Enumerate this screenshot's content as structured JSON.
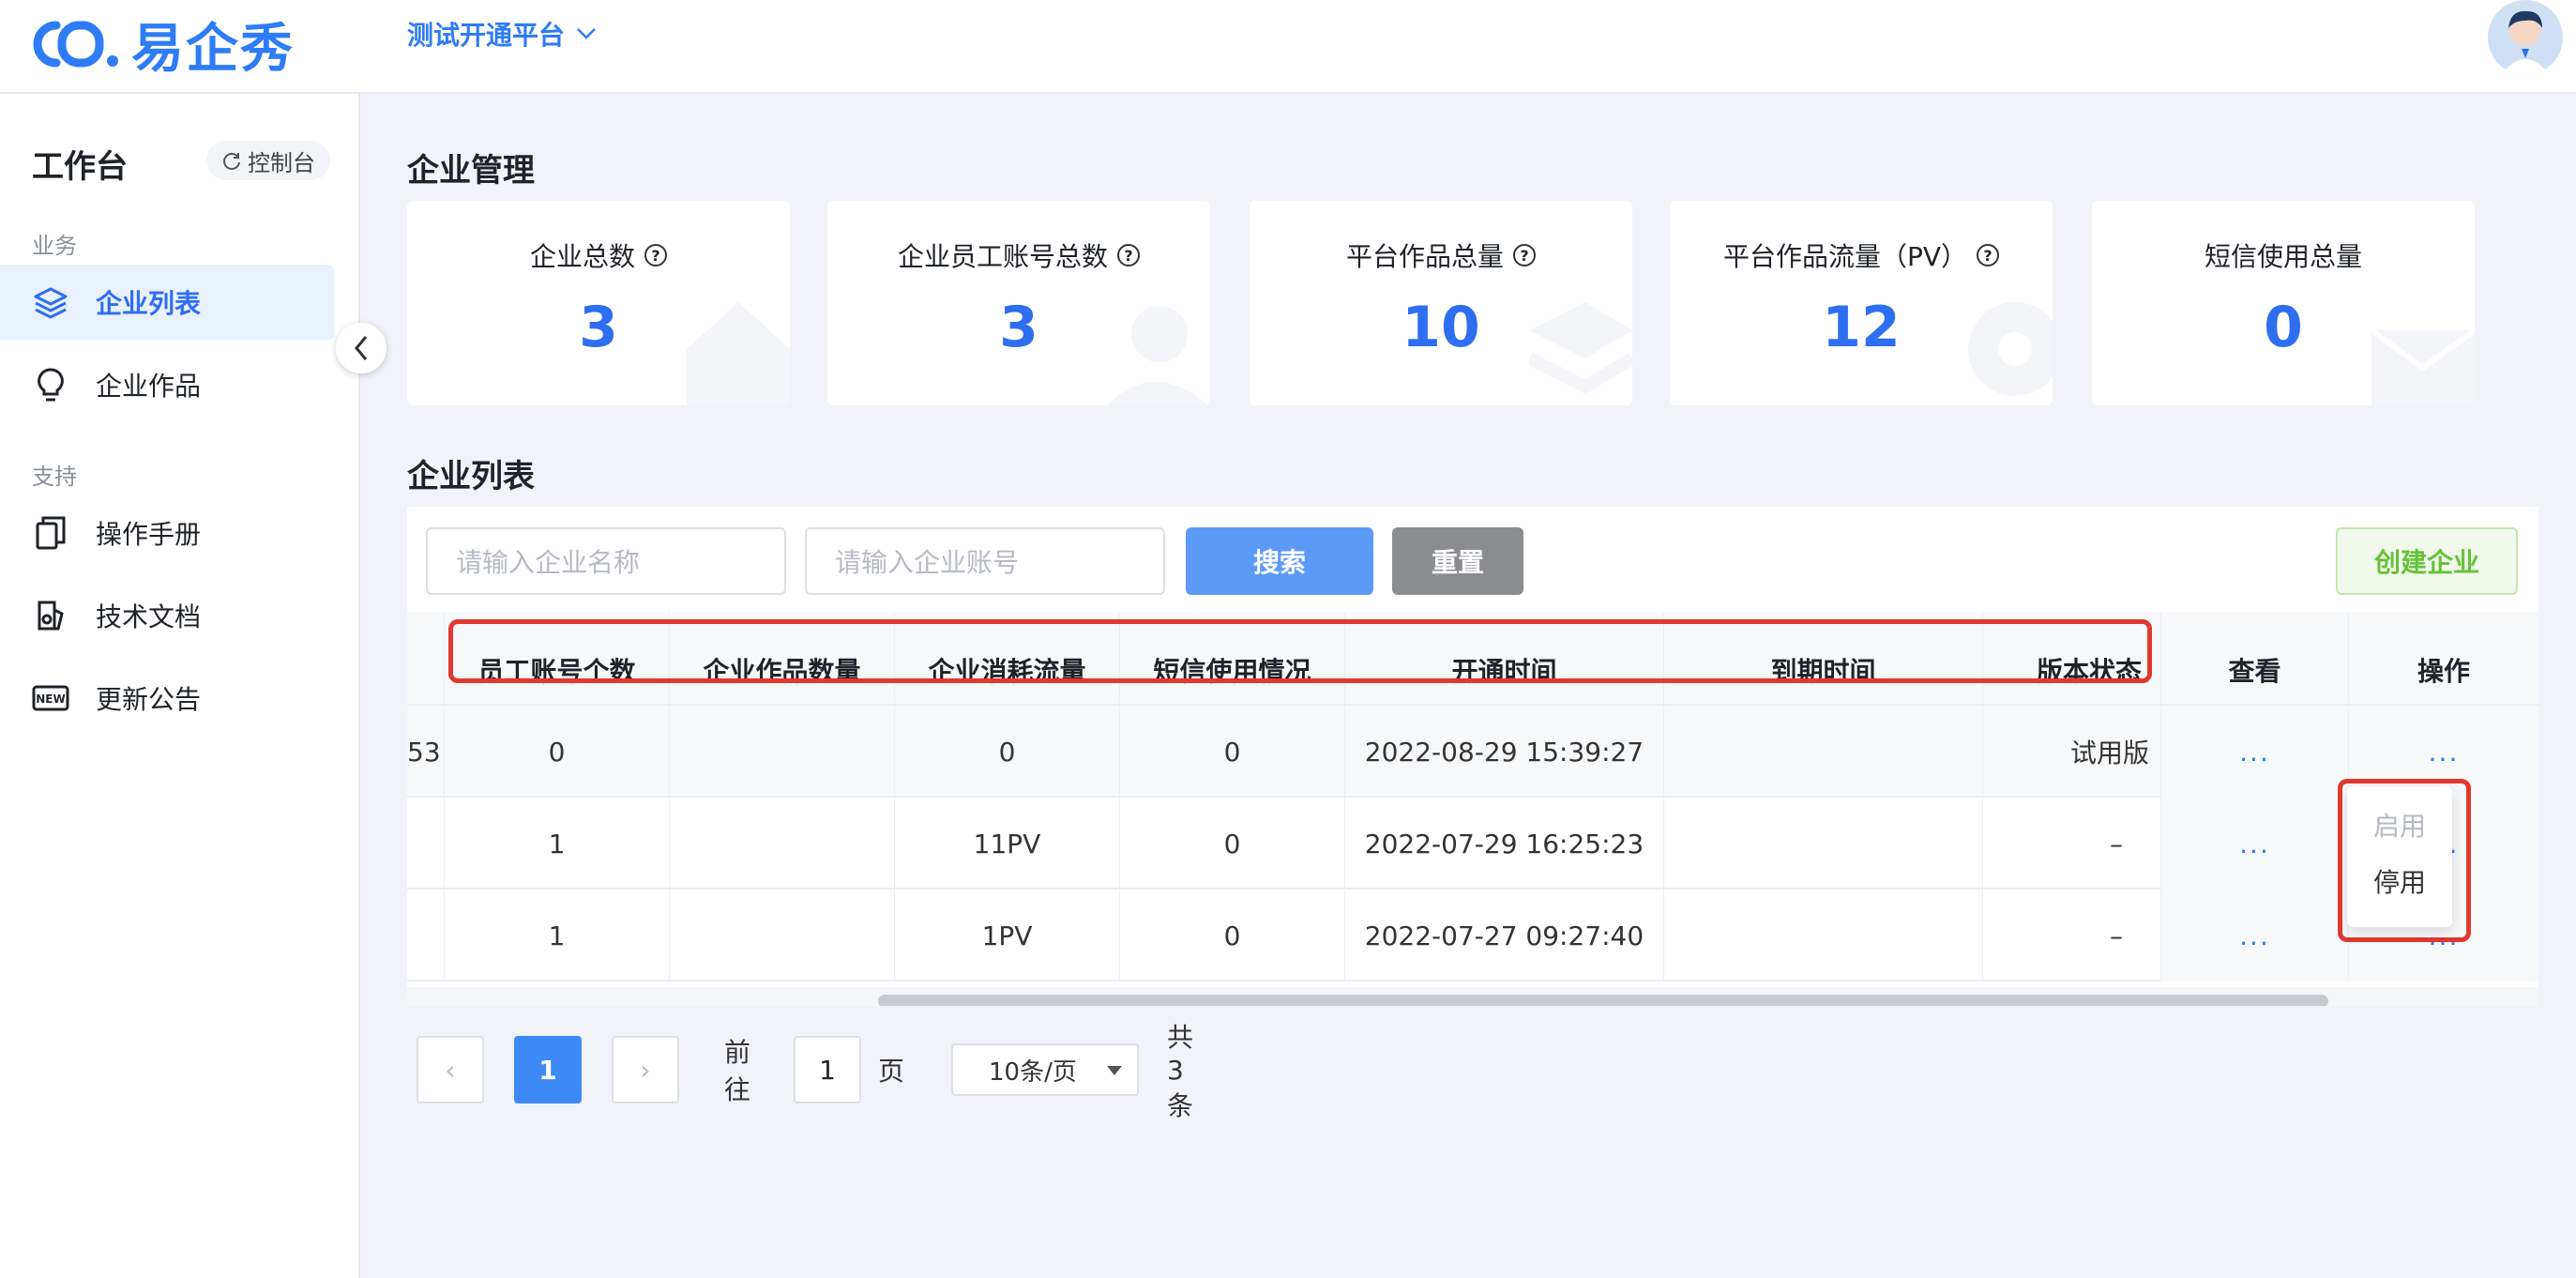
{
  "brand": {
    "logo_mark": "CO.",
    "logo_text": "易企秀",
    "accent_color": "#2e7cf6"
  },
  "header": {
    "platform_name": "测试开通平台"
  },
  "sidebar": {
    "title": "工作台",
    "console_label": "控制台",
    "groups": [
      {
        "label": "业务",
        "items": [
          {
            "label": "企业列表",
            "icon": "layers-icon",
            "active": true
          },
          {
            "label": "企业作品",
            "icon": "bulb-icon",
            "active": false
          }
        ]
      },
      {
        "label": "支持",
        "items": [
          {
            "label": "操作手册",
            "icon": "manual-icon"
          },
          {
            "label": "技术文档",
            "icon": "document-icon"
          },
          {
            "label": "更新公告",
            "icon": "new-icon"
          }
        ]
      }
    ]
  },
  "management": {
    "title": "企业管理",
    "stats": [
      {
        "label": "企业总数",
        "value": "3",
        "help": true
      },
      {
        "label": "企业员工账号总数",
        "value": "3",
        "help": true
      },
      {
        "label": "平台作品总量",
        "value": "10",
        "help": true
      },
      {
        "label": "平台作品流量（PV）",
        "value": "12",
        "help": true
      },
      {
        "label": "短信使用总量",
        "value": "0",
        "help": false
      }
    ]
  },
  "list": {
    "title": "企业列表",
    "search_name_placeholder": "请输入企业名称",
    "search_account_placeholder": "请输入企业账号",
    "search_button": "搜索",
    "reset_button": "重置",
    "create_button": "创建企业",
    "columns": [
      "员工账号个数",
      "企业作品数量",
      "企业消耗流量",
      "短信使用情况",
      "开通时间",
      "到期时间",
      "版本状态",
      "查看",
      "操作"
    ],
    "rows": [
      {
        "partial": "53",
        "employees": "0",
        "works": "",
        "traffic": "0",
        "sms": "0",
        "opened": "2022-08-29 15:39:27",
        "expires": "",
        "version": "试用版",
        "view": "...",
        "action": "..."
      },
      {
        "partial": "",
        "employees": "1",
        "works": "",
        "traffic": "11PV",
        "sms": "0",
        "opened": "2022-07-29 16:25:23",
        "expires": "",
        "version": "–",
        "view": "...",
        "action": "..."
      },
      {
        "partial": "",
        "employees": "1",
        "works": "",
        "traffic": "1PV",
        "sms": "0",
        "opened": "2022-07-27 09:27:40",
        "expires": "",
        "version": "–",
        "view": "...",
        "action": "..."
      }
    ]
  },
  "action_menu": {
    "enable": "启用",
    "disable": "停用"
  },
  "pagination": {
    "prev": "‹",
    "next": "›",
    "current_page": "1",
    "goto_label": "前往",
    "goto_value": "1",
    "page_unit": "页",
    "page_size": "10条/页",
    "total": "共 3 条"
  }
}
